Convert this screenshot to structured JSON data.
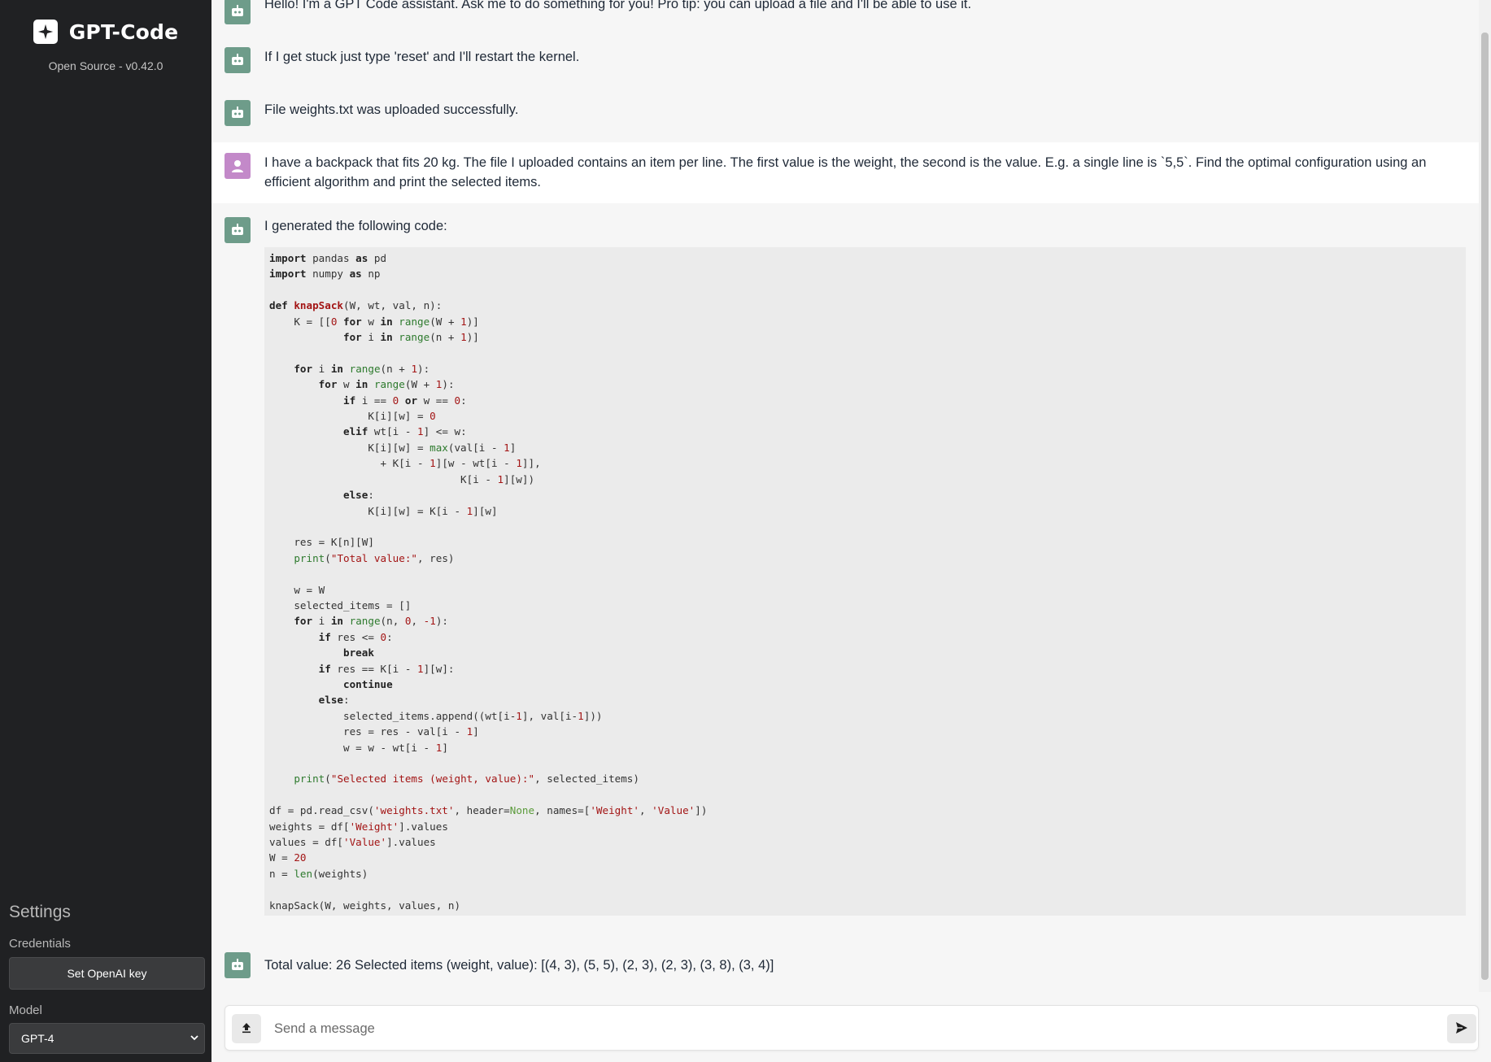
{
  "sidebar": {
    "app_title": "GPT-Code",
    "version": "Open Source - v0.42.0",
    "settings_title": "Settings",
    "credentials_label": "Credentials",
    "credentials_button": "Set OpenAI key",
    "model_label": "Model",
    "model_selected": "GPT-4",
    "logo_icon": "sparkle-logo-icon"
  },
  "messages": [
    {
      "role": "bot",
      "text": "Hello! I'm a GPT Code assistant. Ask me to do something for you! Pro tip: you can upload a file and I'll be able to use it."
    },
    {
      "role": "bot",
      "text": "If I get stuck just type 'reset' and I'll restart the kernel."
    },
    {
      "role": "bot",
      "text": "File weights.txt was uploaded successfully."
    },
    {
      "role": "user",
      "text": "I have a backpack that fits 20 kg. The file I uploaded contains an item per line. The first value is the weight, the second is the value. E.g. a single line is `5,5`. Find the optimal configuration using an efficient algorithm and print the selected items."
    },
    {
      "role": "bot",
      "text": "I generated the following code:"
    },
    {
      "role": "bot",
      "text": "Total value: 26 Selected items (weight, value): [(4, 3), (5, 5), (2, 3), (2, 3), (3, 8), (3, 4)]"
    }
  ],
  "code_lines": [
    [
      [
        "k",
        "import"
      ],
      [
        "t",
        " pandas "
      ],
      [
        "k",
        "as"
      ],
      [
        "t",
        " pd"
      ]
    ],
    [
      [
        "k",
        "import"
      ],
      [
        "t",
        " numpy "
      ],
      [
        "k",
        "as"
      ],
      [
        "t",
        " np"
      ]
    ],
    [],
    [
      [
        "k",
        "def"
      ],
      [
        "t",
        " "
      ],
      [
        "fn",
        "knapSack"
      ],
      [
        "t",
        "(W, wt, val, n):"
      ]
    ],
    [
      [
        "t",
        "    K = [["
      ],
      [
        "n",
        "0"
      ],
      [
        "t",
        " "
      ],
      [
        "k",
        "for"
      ],
      [
        "t",
        " w "
      ],
      [
        "k",
        "in"
      ],
      [
        "t",
        " "
      ],
      [
        "f",
        "range"
      ],
      [
        "t",
        "(W + "
      ],
      [
        "n",
        "1"
      ],
      [
        "t",
        ")]"
      ]
    ],
    [
      [
        "t",
        "            "
      ],
      [
        "k",
        "for"
      ],
      [
        "t",
        " i "
      ],
      [
        "k",
        "in"
      ],
      [
        "t",
        " "
      ],
      [
        "f",
        "range"
      ],
      [
        "t",
        "(n + "
      ],
      [
        "n",
        "1"
      ],
      [
        "t",
        ")]"
      ]
    ],
    [],
    [
      [
        "t",
        "    "
      ],
      [
        "k",
        "for"
      ],
      [
        "t",
        " i "
      ],
      [
        "k",
        "in"
      ],
      [
        "t",
        " "
      ],
      [
        "f",
        "range"
      ],
      [
        "t",
        "(n + "
      ],
      [
        "n",
        "1"
      ],
      [
        "t",
        "):"
      ]
    ],
    [
      [
        "t",
        "        "
      ],
      [
        "k",
        "for"
      ],
      [
        "t",
        " w "
      ],
      [
        "k",
        "in"
      ],
      [
        "t",
        " "
      ],
      [
        "f",
        "range"
      ],
      [
        "t",
        "(W + "
      ],
      [
        "n",
        "1"
      ],
      [
        "t",
        "):"
      ]
    ],
    [
      [
        "t",
        "            "
      ],
      [
        "k",
        "if"
      ],
      [
        "t",
        " i == "
      ],
      [
        "n",
        "0"
      ],
      [
        "t",
        " "
      ],
      [
        "k",
        "or"
      ],
      [
        "t",
        " w == "
      ],
      [
        "n",
        "0"
      ],
      [
        "t",
        ":"
      ]
    ],
    [
      [
        "t",
        "                K[i][w] = "
      ],
      [
        "n",
        "0"
      ]
    ],
    [
      [
        "t",
        "            "
      ],
      [
        "k",
        "elif"
      ],
      [
        "t",
        " wt[i - "
      ],
      [
        "n",
        "1"
      ],
      [
        "t",
        "] <= w:"
      ]
    ],
    [
      [
        "t",
        "                K[i][w] = "
      ],
      [
        "f",
        "max"
      ],
      [
        "t",
        "(val[i - "
      ],
      [
        "n",
        "1"
      ],
      [
        "t",
        "]"
      ]
    ],
    [
      [
        "t",
        "                  + K[i - "
      ],
      [
        "n",
        "1"
      ],
      [
        "t",
        "][w - wt[i - "
      ],
      [
        "n",
        "1"
      ],
      [
        "t",
        "]],"
      ]
    ],
    [
      [
        "t",
        "                               K[i - "
      ],
      [
        "n",
        "1"
      ],
      [
        "t",
        "][w])"
      ]
    ],
    [
      [
        "t",
        "            "
      ],
      [
        "k",
        "else"
      ],
      [
        "t",
        ":"
      ]
    ],
    [
      [
        "t",
        "                K[i][w] = K[i - "
      ],
      [
        "n",
        "1"
      ],
      [
        "t",
        "][w]"
      ]
    ],
    [],
    [
      [
        "t",
        "    res = K[n][W]"
      ]
    ],
    [
      [
        "t",
        "    "
      ],
      [
        "f",
        "print"
      ],
      [
        "t",
        "("
      ],
      [
        "s",
        "\"Total value:\""
      ],
      [
        "t",
        ", res)"
      ]
    ],
    [],
    [
      [
        "t",
        "    w = W"
      ]
    ],
    [
      [
        "t",
        "    selected_items = []"
      ]
    ],
    [
      [
        "t",
        "    "
      ],
      [
        "k",
        "for"
      ],
      [
        "t",
        " i "
      ],
      [
        "k",
        "in"
      ],
      [
        "t",
        " "
      ],
      [
        "f",
        "range"
      ],
      [
        "t",
        "(n, "
      ],
      [
        "n",
        "0"
      ],
      [
        "t",
        ", "
      ],
      [
        "n",
        "-1"
      ],
      [
        "t",
        "):"
      ]
    ],
    [
      [
        "t",
        "        "
      ],
      [
        "k",
        "if"
      ],
      [
        "t",
        " res <= "
      ],
      [
        "n",
        "0"
      ],
      [
        "t",
        ":"
      ]
    ],
    [
      [
        "t",
        "            "
      ],
      [
        "k",
        "break"
      ]
    ],
    [
      [
        "t",
        "        "
      ],
      [
        "k",
        "if"
      ],
      [
        "t",
        " res == K[i - "
      ],
      [
        "n",
        "1"
      ],
      [
        "t",
        "][w]:"
      ]
    ],
    [
      [
        "t",
        "            "
      ],
      [
        "k",
        "continue"
      ]
    ],
    [
      [
        "t",
        "        "
      ],
      [
        "k",
        "else"
      ],
      [
        "t",
        ":"
      ]
    ],
    [
      [
        "t",
        "            selected_items.append((wt[i-"
      ],
      [
        "n",
        "1"
      ],
      [
        "t",
        "], val[i-"
      ],
      [
        "n",
        "1"
      ],
      [
        "t",
        "]))"
      ]
    ],
    [
      [
        "t",
        "            res = res - val[i - "
      ],
      [
        "n",
        "1"
      ],
      [
        "t",
        "]"
      ]
    ],
    [
      [
        "t",
        "            w = w - wt[i - "
      ],
      [
        "n",
        "1"
      ],
      [
        "t",
        "]"
      ]
    ],
    [],
    [
      [
        "t",
        "    "
      ],
      [
        "f",
        "print"
      ],
      [
        "t",
        "("
      ],
      [
        "s",
        "\"Selected items (weight, value):\""
      ],
      [
        "t",
        ", selected_items)"
      ]
    ],
    [],
    [
      [
        "t",
        "df = pd.read_csv("
      ],
      [
        "s",
        "'weights.txt'"
      ],
      [
        "t",
        ", header="
      ],
      [
        "nn",
        "None"
      ],
      [
        "t",
        ", names=["
      ],
      [
        "s",
        "'Weight'"
      ],
      [
        "t",
        ", "
      ],
      [
        "s",
        "'Value'"
      ],
      [
        "t",
        "])"
      ]
    ],
    [
      [
        "t",
        "weights = df["
      ],
      [
        "s",
        "'Weight'"
      ],
      [
        "t",
        "].values"
      ]
    ],
    [
      [
        "t",
        "values = df["
      ],
      [
        "s",
        "'Value'"
      ],
      [
        "t",
        "].values"
      ]
    ],
    [
      [
        "t",
        "W = "
      ],
      [
        "n",
        "20"
      ]
    ],
    [
      [
        "t",
        "n = "
      ],
      [
        "f",
        "len"
      ],
      [
        "t",
        "(weights)"
      ]
    ],
    [],
    [
      [
        "t",
        "knapSack(W, weights, values, n)"
      ]
    ]
  ],
  "input": {
    "placeholder": "Send a message",
    "upload_icon": "upload-icon",
    "send_icon": "send-icon"
  }
}
